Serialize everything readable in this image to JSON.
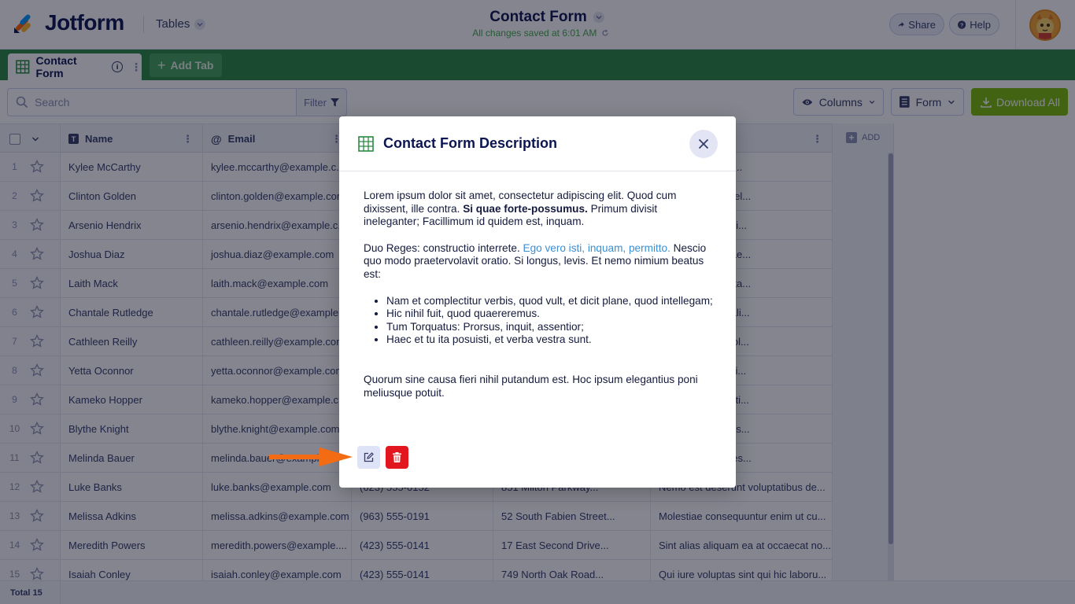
{
  "app": {
    "logo_text": "Jotform",
    "tables_label": "Tables",
    "doc_title": "Contact Form",
    "doc_status": "All changes saved at 6:01 AM",
    "share_label": "Share",
    "help_label": "Help"
  },
  "tabs": {
    "active_label": "Contact Form",
    "add_label": "Add Tab"
  },
  "toolbar": {
    "search_placeholder": "Search",
    "filter_label": "Filter",
    "columns_label": "Columns",
    "form_label": "Form",
    "download_label": "Download All"
  },
  "table": {
    "headers": {
      "name": "Name",
      "email": "Email",
      "add": "ADD"
    },
    "rows": [
      {
        "num": "1",
        "name": "Kylee McCarthy",
        "email": "kylee.mccarthy@example.c...",
        "phone": "",
        "address": "",
        "message": "dit non laudantiu..."
      },
      {
        "num": "2",
        "name": "Clinton Golden",
        "email": "clinton.golden@example.com",
        "phone": "",
        "address": "",
        "message": "nde nulla eaque el..."
      },
      {
        "num": "3",
        "name": "Arsenio Hendrix",
        "email": "arsenio.hendrix@example.c...",
        "phone": "",
        "address": "",
        "message": "strud quasi cupidi..."
      },
      {
        "num": "4",
        "name": "Joshua Diaz",
        "email": "joshua.diaz@example.com",
        "phone": "",
        "address": "",
        "message": "o eius sunt beatae..."
      },
      {
        "num": "5",
        "name": "Laith Mack",
        "email": "laith.mack@example.com",
        "phone": "",
        "address": "",
        "message": "dolor anim volupta..."
      },
      {
        "num": "6",
        "name": "Chantale Rutledge",
        "email": "chantale.rutledge@example...",
        "phone": "",
        "address": "",
        "message": "sit consequatur ali..."
      },
      {
        "num": "7",
        "name": "Cathleen Reilly",
        "email": "cathleen.reilly@example.com",
        "phone": "",
        "address": "",
        "message": "m irure ratione vol..."
      },
      {
        "num": "8",
        "name": "Yetta Oconnor",
        "email": "yetta.oconnor@example.com",
        "phone": "",
        "address": "",
        "message": "am nostrum omni..."
      },
      {
        "num": "9",
        "name": "Kameko Hopper",
        "email": "kameko.hopper@example.c...",
        "phone": "",
        "address": "",
        "message": "esciunt quia debiti..."
      },
      {
        "num": "10",
        "name": "Blythe Knight",
        "email": "blythe.knight@example.com",
        "phone": "",
        "address": "",
        "message": "nt excepturi dignis..."
      },
      {
        "num": "11",
        "name": "Melinda Bauer",
        "email": "melinda.bauer@example.com",
        "phone": "",
        "address": "",
        "message": "nim eaque dolores..."
      },
      {
        "num": "12",
        "name": "Luke Banks",
        "email": "luke.banks@example.com",
        "phone": "(623) 555-0152",
        "address": "851 Milton Parkway...",
        "message": "Nemo est deserunt voluptatibus de..."
      },
      {
        "num": "13",
        "name": "Melissa Adkins",
        "email": "melissa.adkins@example.com",
        "phone": "(963) 555-0191",
        "address": "52 South Fabien Street...",
        "message": "Molestiae consequuntur enim ut cu..."
      },
      {
        "num": "14",
        "name": "Meredith Powers",
        "email": "meredith.powers@example....",
        "phone": "(423) 555-0141",
        "address": "17 East Second Drive...",
        "message": "Sint alias aliquam ea at occaecat no..."
      },
      {
        "num": "15",
        "name": "Isaiah Conley",
        "email": "isaiah.conley@example.com",
        "phone": "(423) 555-0141",
        "address": "749 North Oak Road...",
        "message": "Qui iure voluptas sint qui hic laboru..."
      }
    ]
  },
  "footer": {
    "total": "Total 15"
  },
  "modal": {
    "title": "Contact Form Description",
    "p1_a": "Lorem ipsum dolor sit amet, consectetur adipiscing elit. Quod cum dixissent, ille contra. ",
    "p1_bold": "Si quae forte-possumus.",
    "p1_b": " Primum divisit ineleganter; Facillimum id quidem est, inquam.",
    "p2_a": "Duo Reges: constructio interrete. ",
    "p2_link": "Ego vero isti, inquam, permitto.",
    "p2_b": " Nescio quo modo praetervolavit oratio. Si longus, levis. Et nemo nimium beatus est:",
    "list": [
      "Nam et complectitur verbis, quod vult, et dicit plane, quod intellegam;",
      "Hic nihil fuit, quod quaereremus.",
      "Tum Torquatus: Prorsus, inquit, assentior;",
      "Haec et tu ita posuisti, et verba vestra sunt."
    ],
    "p3": "Quorum sine causa fieri nihil putandum est. Hoc ipsum elegantius poni meliusque potuit."
  },
  "colors": {
    "brand_green": "#2a8a43",
    "download_green": "#78bb07",
    "delete_red": "#e2161e",
    "arrow_orange": "#f36b12",
    "link_blue": "#3a8fd6"
  }
}
